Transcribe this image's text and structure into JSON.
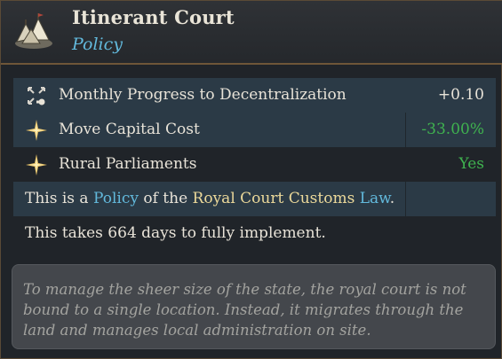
{
  "header": {
    "title": "Itinerant Court",
    "subtitle": "Policy",
    "icon": "tent-camp-icon"
  },
  "modifiers": [
    {
      "icon": "decentralize-arrows-icon",
      "label": "Monthly Progress to Decentralization",
      "value": "+0.10",
      "value_color": "#e8e3d8"
    },
    {
      "icon": "compass-star-icon",
      "label": "Move Capital Cost",
      "value": "-33.00%",
      "value_color": "#3fb24f"
    },
    {
      "icon": "compass-star-icon",
      "label": "Rural Parliaments",
      "value": "Yes",
      "value_color": "#3fb24f"
    }
  ],
  "policy_line": {
    "prefix": "This is a ",
    "policy_word": "Policy",
    "middle": " of the ",
    "customs_name": "Royal Court Customs",
    "space": " ",
    "law_word": "Law",
    "suffix": "."
  },
  "implement_line": "This takes 664 days to fully implement.",
  "flavor_text": "To manage the sheer size of the state, the royal court is not bound to a single location. Instead, it migrates through the land and manages local administration on site.",
  "colors": {
    "accent_blue": "#62b9dc",
    "positive_green": "#3fb24f",
    "highlight_gold": "#ecd99a",
    "border_brown": "#6f5638"
  }
}
